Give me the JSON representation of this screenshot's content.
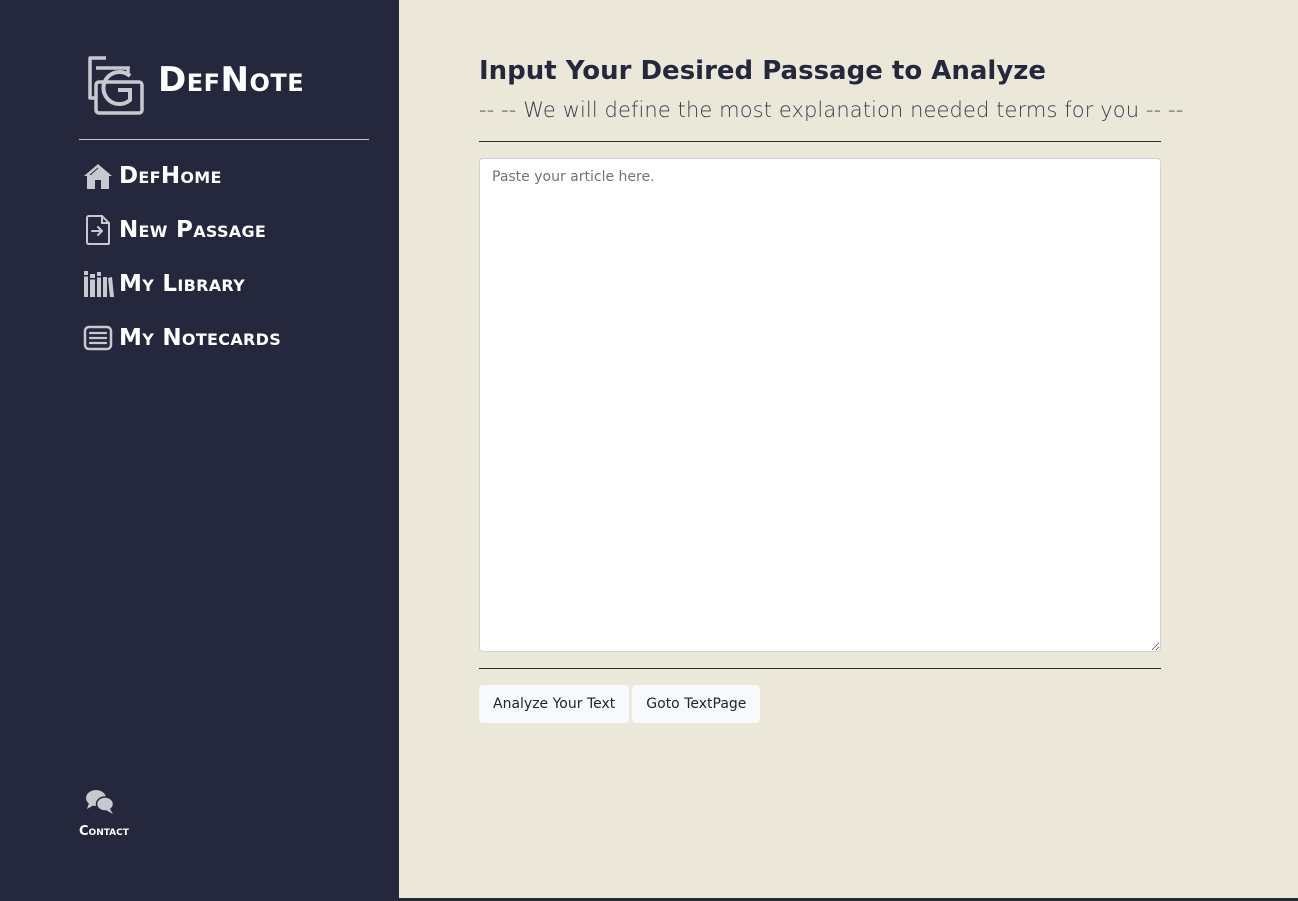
{
  "brand": {
    "name": "DefNote",
    "logo_icon": "defnote-logo-icon"
  },
  "nav": {
    "items": [
      {
        "label": "DefHome",
        "icon": "home-icon"
      },
      {
        "label": "New Passage",
        "icon": "file-import-icon"
      },
      {
        "label": "My Library",
        "icon": "books-icon"
      },
      {
        "label": "My Notecards",
        "icon": "notecard-icon"
      }
    ]
  },
  "contact": {
    "label": "Contact",
    "icon": "chat-bubbles-icon"
  },
  "main": {
    "title": "Input Your Desired Passage to Analyze",
    "subtitle": "-- -- We will define the most explanation needed terms for you -- --",
    "textarea": {
      "placeholder": "Paste your article here.",
      "value": ""
    },
    "buttons": {
      "analyze": "Analyze Your Text",
      "goto": "Goto TextPage"
    }
  },
  "colors": {
    "sidebar": "#25283d",
    "background": "#ece8d9",
    "button": "#f8f9fa",
    "icon": "#c8c9d0"
  }
}
